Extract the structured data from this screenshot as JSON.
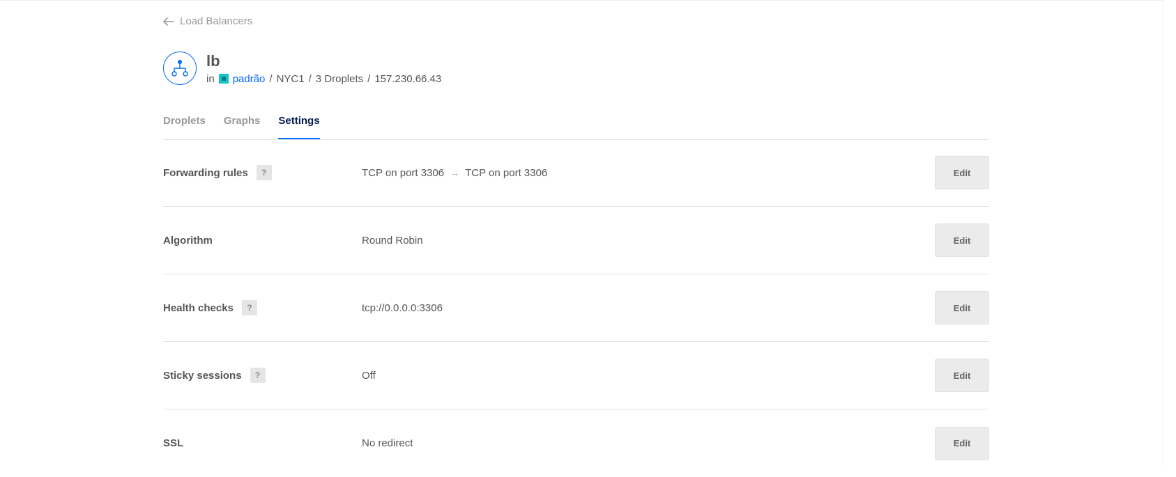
{
  "breadcrumb": {
    "back_label": "Load Balancers"
  },
  "header": {
    "name": "lb",
    "in_label": "in",
    "project": "padrão",
    "separator": "/",
    "region": "NYC1",
    "droplets": "3 Droplets",
    "ip": "157.230.66.43"
  },
  "tabs": [
    {
      "label": "Droplets",
      "active": false
    },
    {
      "label": "Graphs",
      "active": false
    },
    {
      "label": "Settings",
      "active": true
    }
  ],
  "settings": {
    "help_glyph": "?",
    "edit_label": "Edit",
    "rows": [
      {
        "label": "Forwarding rules",
        "has_help": true,
        "value_from": "TCP on port 3306",
        "arrow": "→",
        "value_to": "TCP on port 3306"
      },
      {
        "label": "Algorithm",
        "has_help": false,
        "value": "Round Robin"
      },
      {
        "label": "Health checks",
        "has_help": true,
        "value": "tcp://0.0.0.0:3306"
      },
      {
        "label": "Sticky sessions",
        "has_help": true,
        "value": "Off"
      },
      {
        "label": "SSL",
        "has_help": false,
        "value": "No redirect"
      }
    ]
  },
  "colors": {
    "accent": "#0069ff",
    "active_tab": "#031b4e",
    "project_icon": "#13c5c7"
  },
  "icons": {
    "back": "arrow-left-icon",
    "load_balancer": "load-balancer-icon",
    "project": "project-icon",
    "help": "help-icon"
  }
}
